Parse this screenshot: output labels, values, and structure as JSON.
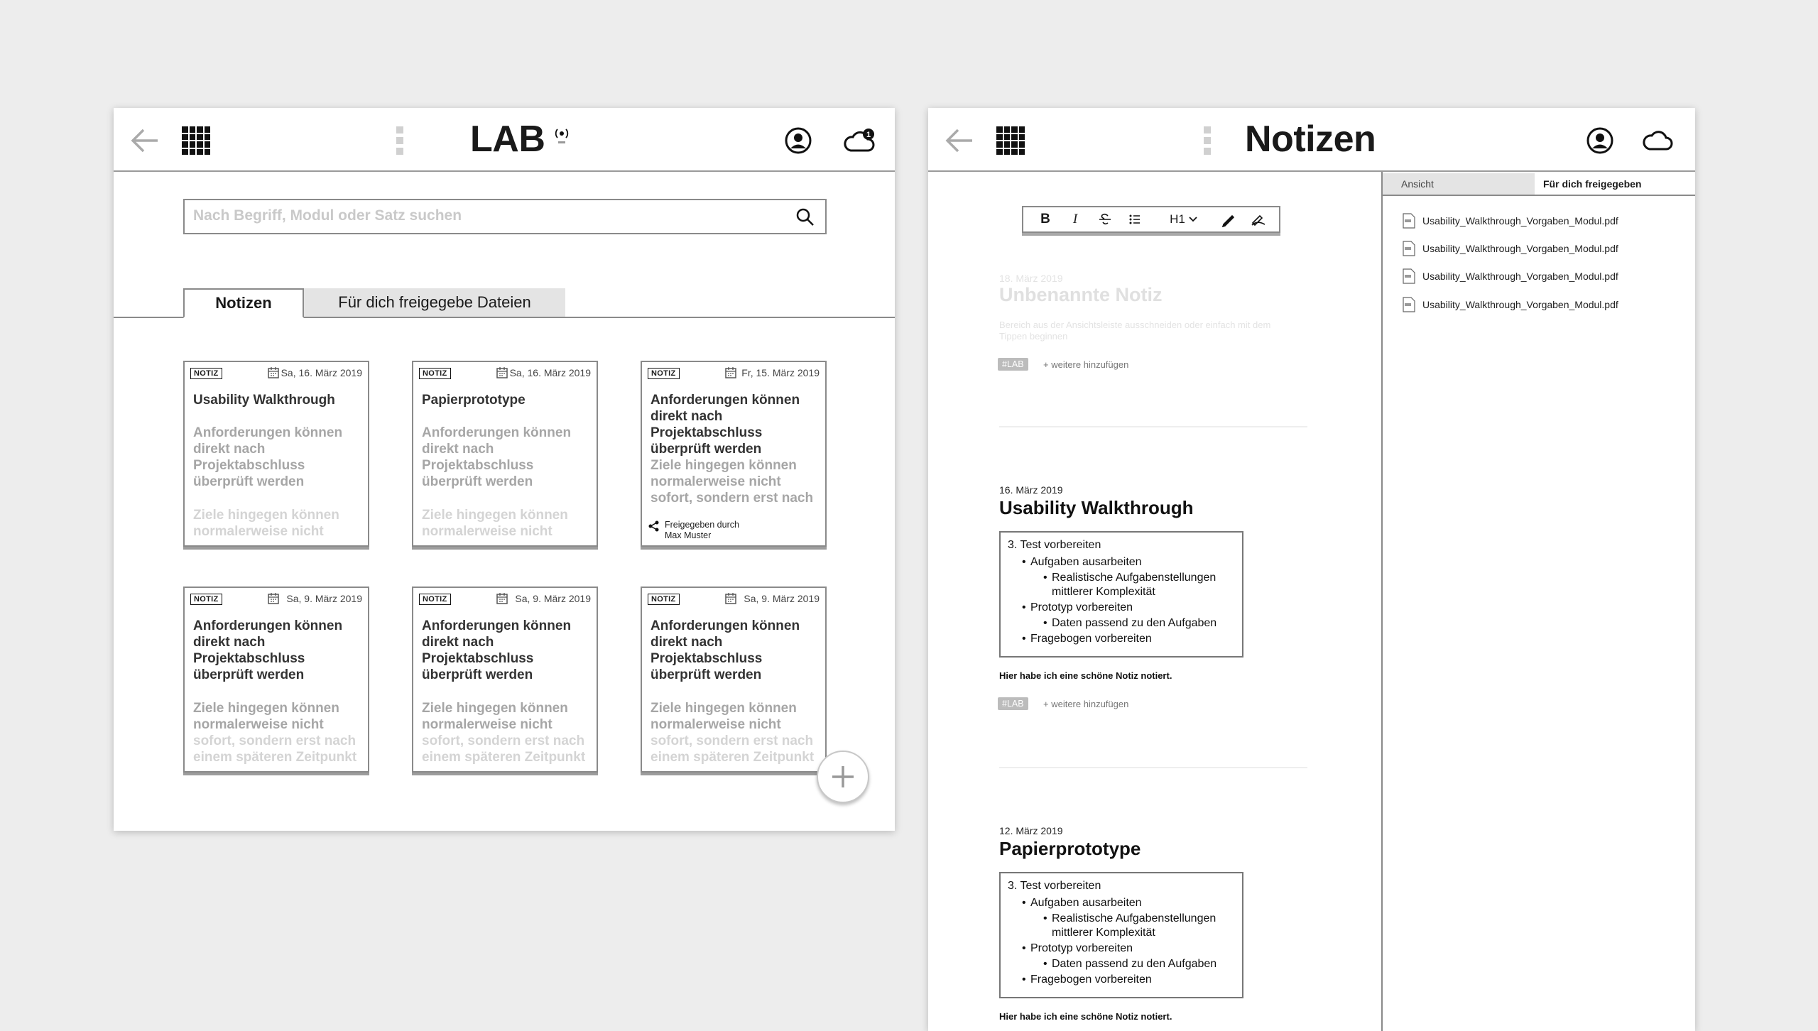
{
  "left": {
    "title": "LAB",
    "search": {
      "placeholder": "Nach Begriff, Modul oder Satz suchen"
    },
    "tabs": [
      {
        "label": "Notizen"
      },
      {
        "label": "Für dich freigegebe Dateien"
      }
    ],
    "cards": [
      {
        "badge": "NOTIZ",
        "date": "Sa, 16. März 2019",
        "title": "Usability Walkthrough",
        "body": "Anforderungen können direkt nach Projektabschluss überprüft werden",
        "fade": "Ziele hingegen können normalerweise nicht"
      },
      {
        "badge": "NOTIZ",
        "date": "Sa, 16. März 2019",
        "title": "Papierprototype",
        "body": "Anforderungen können direkt nach Projektabschluss überprüft werden",
        "fade": "Ziele hingegen können normalerweise nicht"
      },
      {
        "badge": "NOTIZ",
        "date": "Fr, 15. März 2019",
        "title": "Anforderungen können direkt nach Projektabschluss überprüft werden",
        "body": "Ziele hingegen können normalerweise nicht sofort, sondern erst nach",
        "shared": "Freigegeben durch",
        "shared_by": "Max Muster"
      },
      {
        "badge": "NOTIZ",
        "date": "Sa, 9. März 2019",
        "title": "Anforderungen können direkt nach Projektabschluss überprüft werden",
        "body": "Ziele hingegen können normalerweise nicht",
        "fade": "sofort, sondern erst nach einem späteren Zeitpunkt"
      },
      {
        "badge": "NOTIZ",
        "date": "Sa, 9. März 2019",
        "title": "Anforderungen können direkt nach Projektabschluss überprüft werden",
        "body": "Ziele hingegen können normalerweise nicht",
        "fade": "sofort, sondern erst nach einem späteren Zeitpunkt"
      },
      {
        "badge": "NOTIZ",
        "date": "Sa, 9. März 2019",
        "title": "Anforderungen können direkt nach Projektabschluss überprüft werden",
        "body": "Ziele hingegen können normalerweise nicht",
        "fade": "sofort, sondern erst nach einem späteren Zeitpunkt"
      }
    ],
    "icons": [
      "back-arrow-icon",
      "app-grid-icon",
      "kebab-icon",
      "live-icon",
      "user-icon",
      "cloud-notification-icon",
      "search-icon",
      "calendar-icon",
      "share-icon",
      "plus-icon"
    ]
  },
  "right": {
    "title": "Notizen",
    "tabs": [
      {
        "label": "Ansicht"
      },
      {
        "label": "Für dich freigegeben"
      }
    ],
    "files": [
      "Usability_Walkthrough_Vorgaben_Modul.pdf",
      "Usability_Walkthrough_Vorgaben_Modul.pdf",
      "Usability_Walkthrough_Vorgaben_Modul.pdf",
      "Usability_Walkthrough_Vorgaben_Modul.pdf"
    ],
    "toolbar": {
      "bold": "B",
      "italic": "I",
      "heading": "H1"
    },
    "draft": {
      "date": "18. März 2019",
      "title": "Unbenannte Notiz",
      "hint": "Bereich aus der Ansichtsleiste ausschneiden oder einfach mit dem Tippen beginnen",
      "tag": "#LAB",
      "add_tag": "+ weitere hinzufügen"
    },
    "notes": [
      {
        "date": "16. März 2019",
        "title": "Usability Walkthrough",
        "heading": "3. Test vorbereiten",
        "items": [
          "Aufgaben ausarbeiten",
          "Realistische Aufgabenstellungen mittlerer Komplexität",
          "Prototyp vorbereiten",
          "Daten passend zu den Aufgaben",
          "Fragebogen vorbereiten"
        ],
        "after": "Hier habe ich eine schöne Notiz notiert.",
        "tag": "#LAB",
        "add_tag": "+ weitere hinzufügen"
      },
      {
        "date": "12. März 2019",
        "title": "Papierprototype",
        "heading": "3. Test vorbereiten",
        "items": [
          "Aufgaben ausarbeiten",
          "Realistische Aufgabenstellungen mittlerer Komplexität",
          "Prototyp vorbereiten",
          "Daten passend zu den Aufgaben",
          "Fragebogen vorbereiten"
        ],
        "after": "Hier habe ich eine schöne Notiz notiert."
      }
    ],
    "icons": [
      "back-arrow-icon",
      "app-grid-icon",
      "kebab-icon",
      "user-icon",
      "cloud-icon",
      "pdf-file-icon",
      "bold-icon",
      "italic-icon",
      "strikethrough-icon",
      "list-icon",
      "heading-dropdown-icon",
      "marker-icon",
      "clear-format-icon"
    ]
  }
}
